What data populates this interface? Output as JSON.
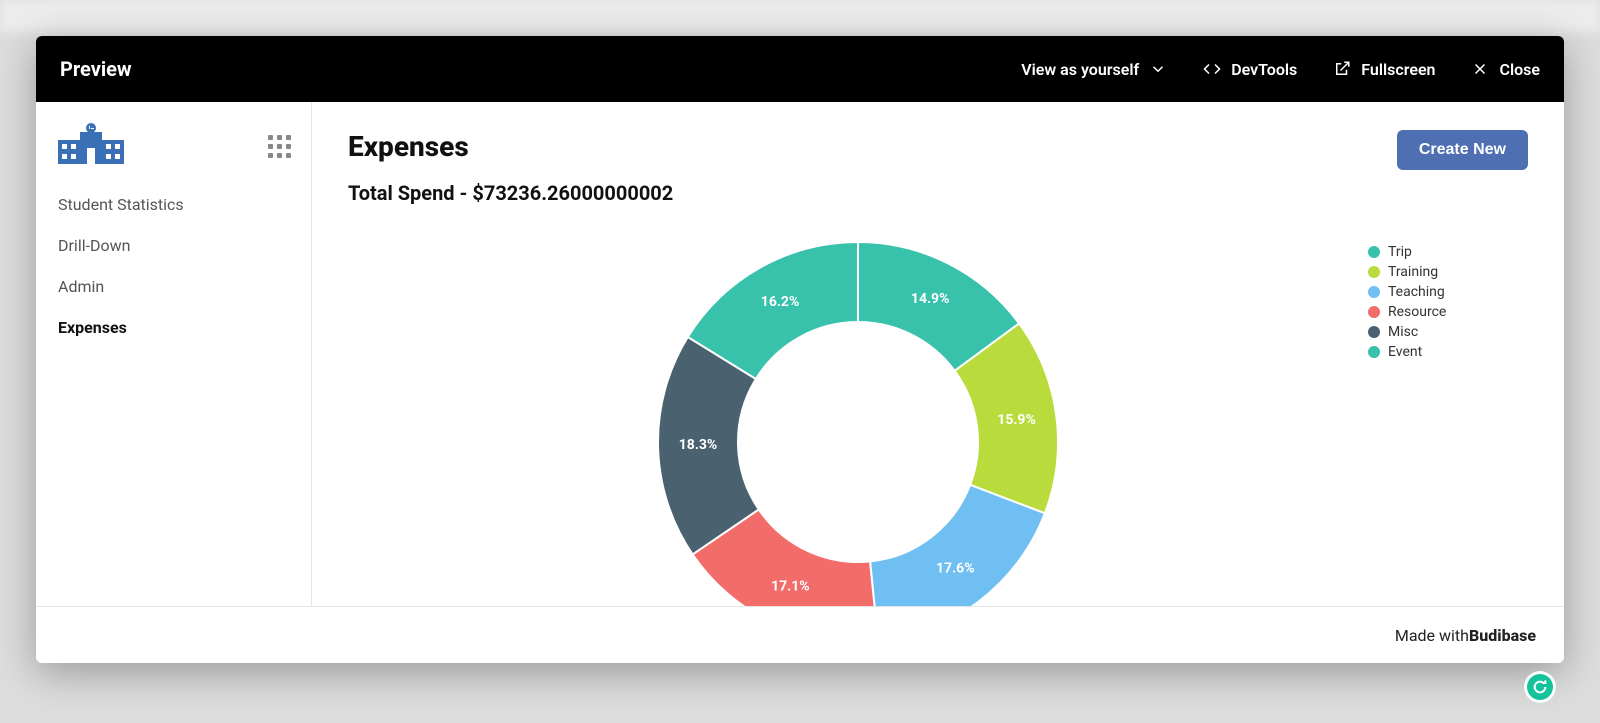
{
  "topbar": {
    "title": "Preview",
    "view_as": "View as yourself",
    "devtools": "DevTools",
    "fullscreen": "Fullscreen",
    "close": "Close"
  },
  "sidebar": {
    "items": [
      {
        "label": "Student Statistics",
        "active": false
      },
      {
        "label": "Drill-Down",
        "active": false
      },
      {
        "label": "Admin",
        "active": false
      },
      {
        "label": "Expenses",
        "active": true
      }
    ]
  },
  "main": {
    "title": "Expenses",
    "total_spend_label": "Total Spend - $73236.26000000002",
    "create_button": "Create New"
  },
  "footer": {
    "prefix": "Made with ",
    "brand": "Budibase"
  },
  "colors": {
    "trip": "#38c2ac",
    "training": "#b9dc3c",
    "teaching": "#6fbff2",
    "resource": "#f26d6a",
    "misc": "#4a6170",
    "event": "#38c2ac",
    "accent_button": "#4f6fb3"
  },
  "chart_data": {
    "type": "pie",
    "title": "Expenses",
    "subtitle": "Total Spend - $73236.26000000002",
    "inner_radius_pct": 60,
    "series": [
      {
        "name": "Trip",
        "value": 14.9,
        "label": "14.9%",
        "color": "#38c2ac"
      },
      {
        "name": "Training",
        "value": 15.9,
        "label": "15.9%",
        "color": "#b9dc3c"
      },
      {
        "name": "Teaching",
        "value": 17.6,
        "label": "17.6%",
        "color": "#6fbff2"
      },
      {
        "name": "Resource",
        "value": 17.1,
        "label": "17.1%",
        "color": "#f26d6a"
      },
      {
        "name": "Misc",
        "value": 18.3,
        "label": "18.3%",
        "color": "#4a6170"
      },
      {
        "name": "Event",
        "value": 16.2,
        "label": "16.2%",
        "color": "#38c2ac"
      }
    ],
    "legend": [
      "Trip",
      "Training",
      "Teaching",
      "Resource",
      "Misc",
      "Event"
    ]
  }
}
